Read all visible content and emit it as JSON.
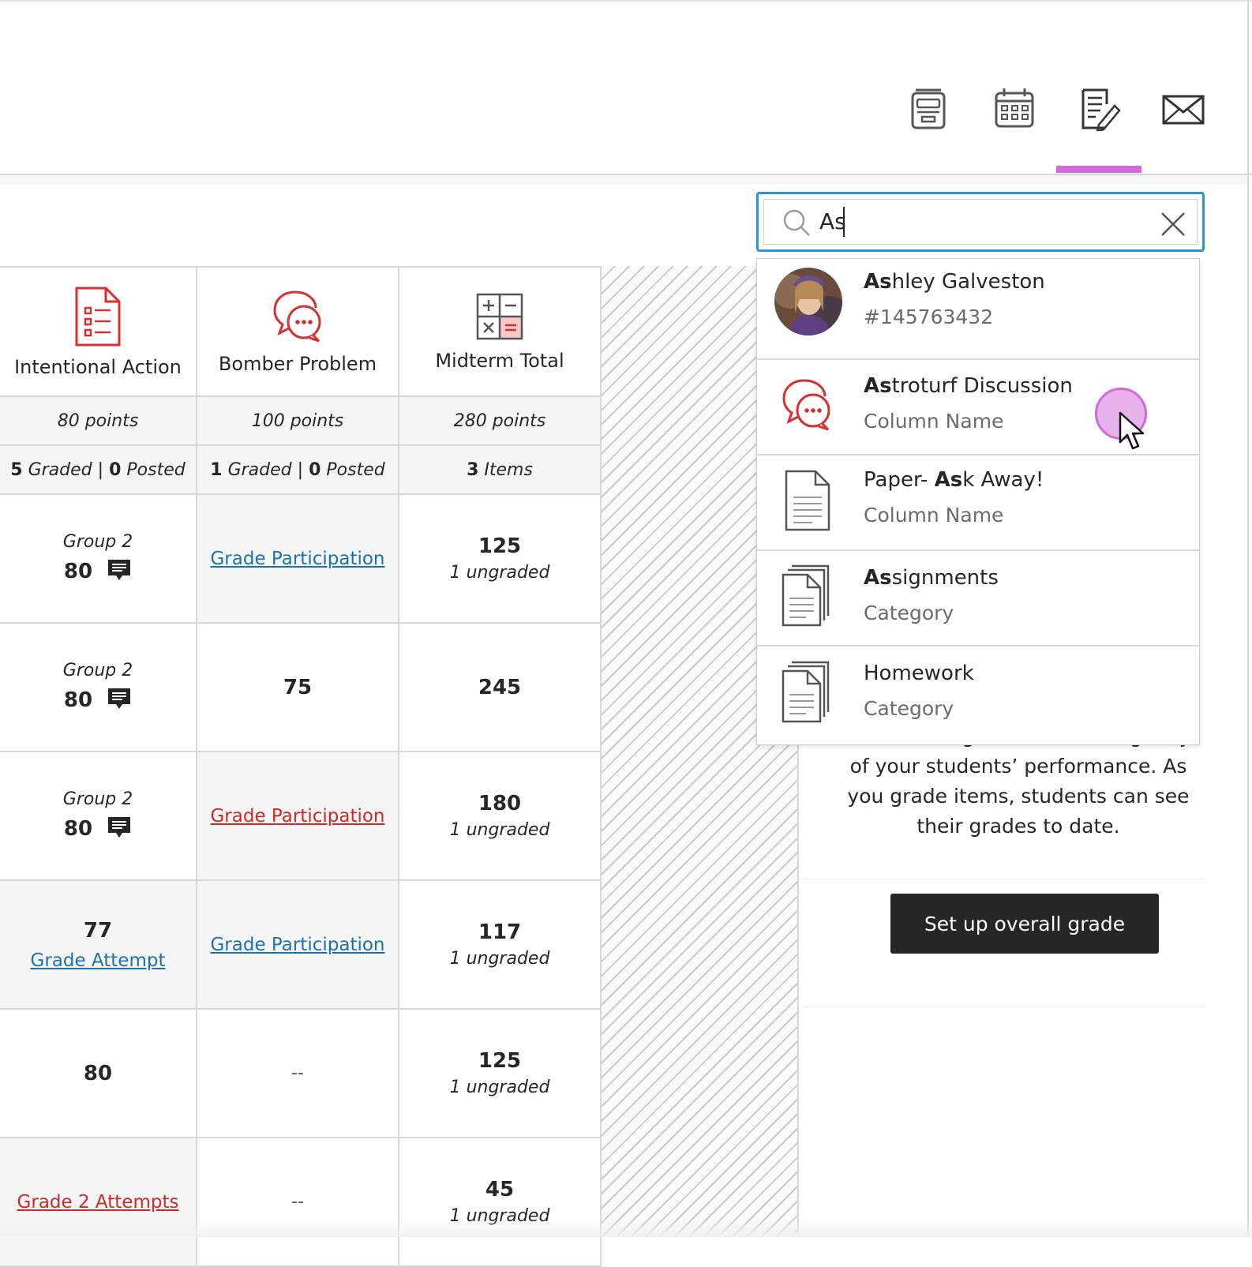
{
  "nav": {
    "icons": [
      "stream-icon",
      "calendar-icon",
      "gradebook-icon",
      "messages-icon"
    ],
    "active_index": 2,
    "accent_color": "#d368dd"
  },
  "search": {
    "value": "As",
    "clear_label": "clear"
  },
  "columns": [
    {
      "name": "Intentional Action",
      "points": "80 points",
      "graded_count": "5",
      "graded_label": "Graded",
      "sep": "|",
      "posted_count": "0",
      "posted_label": "Posted"
    },
    {
      "name": "Bomber Problem",
      "points": "100 points",
      "graded_count": "1",
      "graded_label": "Graded",
      "sep": "|",
      "posted_count": "0",
      "posted_label": "Posted"
    },
    {
      "name": "Midterm Total",
      "points": "280 points",
      "items_count": "3",
      "items_label": "Items"
    }
  ],
  "rows": [
    {
      "c1_group": "Group 2",
      "c1_score": "80",
      "c2_link": "Grade Participation",
      "c3_value": "125",
      "c3_sub": "1 ungraded"
    },
    {
      "c1_group": "Group 2",
      "c1_score": "80",
      "c2_value": "75",
      "c3_value": "245"
    },
    {
      "c1_group": "Group 2",
      "c1_score": "80",
      "c2_link": "Grade Participation",
      "c3_value": "180",
      "c3_sub": "1 ungraded"
    },
    {
      "c1_score": "77",
      "c1_link": "Grade Attempt",
      "c2_link": "Grade Participation",
      "c3_value": "117",
      "c3_sub": "1 ungraded"
    },
    {
      "c1_score": "80",
      "c2_value": "--",
      "c3_value": "125",
      "c3_sub": "1 ungraded"
    },
    {
      "c1_link": "Grade 2 Attempts",
      "c2_value": "--",
      "c3_value": "45",
      "c3_sub": "1 ungraded"
    }
  ],
  "overall": {
    "text": "The overall grade is a running tally of your students’ performance. As you grade items, students can see their grades to date.",
    "button": "Set up overall grade"
  },
  "dropdown": [
    {
      "match": "As",
      "rest": "hley Galveston",
      "prefix": "",
      "sub": "#145763432",
      "icon": "student-avatar"
    },
    {
      "match": "As",
      "rest": "troturf Discussion",
      "prefix": "",
      "sub": "Column Name",
      "icon": "discussion-icon"
    },
    {
      "prefix": "Paper- ",
      "match": "As",
      "rest": "k Away!",
      "sub": "Column Name",
      "icon": "document-icon"
    },
    {
      "match": "As",
      "rest": "signments",
      "prefix": "",
      "sub": "Category",
      "icon": "category-icon"
    },
    {
      "match": "",
      "rest": "Homework",
      "prefix": "",
      "sub": "Category",
      "icon": "category-icon"
    }
  ],
  "colors": {
    "link_blue": "#1a73b0",
    "link_red": "#cf2a2a",
    "focus_blue": "#2a94d6",
    "icon_red": "#d72e2e"
  }
}
